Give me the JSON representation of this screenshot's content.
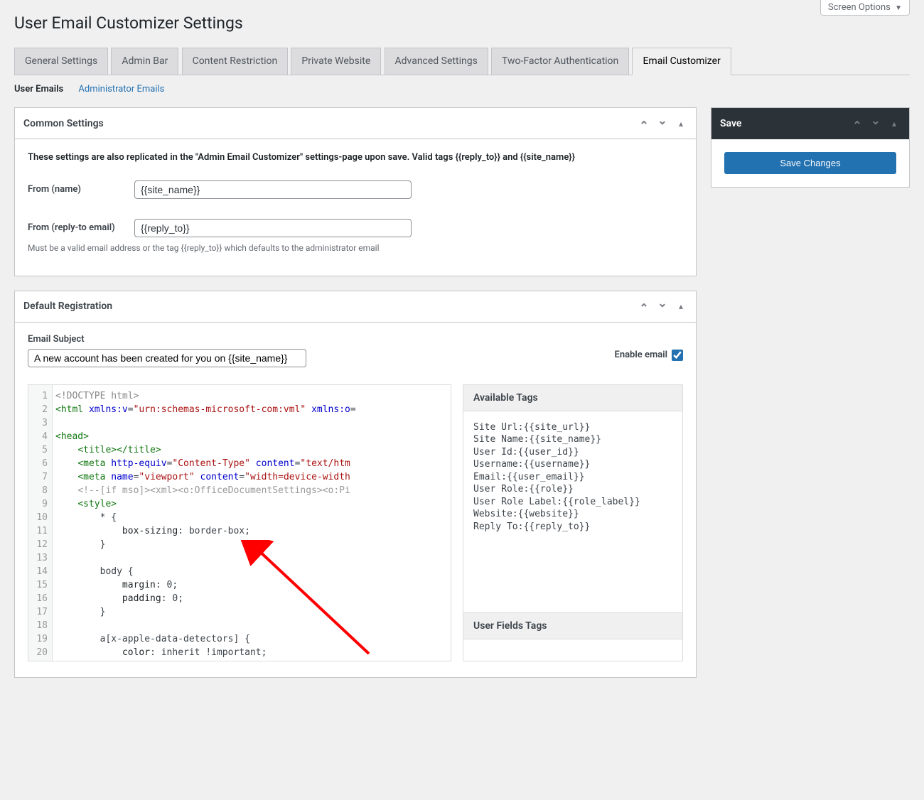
{
  "screen_options": "Screen Options",
  "page_title": "User Email Customizer Settings",
  "tabs": [
    "General Settings",
    "Admin Bar",
    "Content Restriction",
    "Private Website",
    "Advanced Settings",
    "Two-Factor Authentication",
    "Email Customizer"
  ],
  "tabs_active_index": 6,
  "sub_tabs": {
    "active": "User Emails",
    "link": "Administrator Emails"
  },
  "common": {
    "title": "Common Settings",
    "description": "These settings are also replicated in the \"Admin Email Customizer\" settings-page upon save. Valid tags {{reply_to}} and {{site_name}}",
    "from_name_label": "From (name)",
    "from_name_value": "{{site_name}}",
    "from_email_label": "From (reply-to email)",
    "from_email_value": "{{reply_to}}",
    "from_email_desc": "Must be a valid email address or the tag {{reply_to}} which defaults to the administrator email"
  },
  "registration": {
    "title": "Default Registration",
    "subject_label": "Email Subject",
    "subject_value": "A new account has been created for you on {{site_name}}",
    "enable_label": "Enable email",
    "enable_checked": true,
    "available_tags_title": "Available Tags",
    "available_tags": [
      "Site Url:{{site_url}}",
      "Site Name:{{site_name}}",
      "User Id:{{user_id}}",
      "Username:{{username}}",
      "Email:{{user_email}}",
      "User Role:{{role}}",
      "User Role Label:{{role_label}}",
      "Website:{{website}}",
      "Reply To:{{reply_to}}"
    ],
    "user_fields_title": "User Fields Tags",
    "code_lines": [
      {
        "n": 1,
        "html": "<span class='tok-doctype'>&lt;!DOCTYPE html&gt;</span>"
      },
      {
        "n": 2,
        "html": "<span class='tok-tag'>&lt;html</span> <span class='tok-attr'>xmlns:v</span>=<span class='tok-str'>\"urn:schemas-microsoft-com:vml\"</span> <span class='tok-attr'>xmlns:o</span>="
      },
      {
        "n": 3,
        "html": ""
      },
      {
        "n": 4,
        "html": "<span class='tok-tag'>&lt;head&gt;</span>"
      },
      {
        "n": 5,
        "html": "    <span class='tok-tag'>&lt;title&gt;&lt;/title&gt;</span>"
      },
      {
        "n": 6,
        "html": "    <span class='tok-tag'>&lt;meta</span> <span class='tok-attr'>http-equiv</span>=<span class='tok-str'>\"Content-Type\"</span> <span class='tok-attr'>content</span>=<span class='tok-str'>\"text/htm</span>"
      },
      {
        "n": 7,
        "html": "    <span class='tok-tag'>&lt;meta</span> <span class='tok-attr'>name</span>=<span class='tok-str'>\"viewport\"</span> <span class='tok-attr'>content</span>=<span class='tok-str'>\"width=device-width</span>"
      },
      {
        "n": 8,
        "html": "    <span class='tok-comment'>&lt;!--[if mso]&gt;&lt;xml&gt;&lt;o:OfficeDocumentSettings&gt;&lt;o:Pi</span>"
      },
      {
        "n": 9,
        "html": "    <span class='tok-tag'>&lt;style&gt;</span>"
      },
      {
        "n": 10,
        "html": "        * {"
      },
      {
        "n": 11,
        "html": "            <span class='tok-prop'>box-sizing</span>: border-box;"
      },
      {
        "n": 12,
        "html": "        }"
      },
      {
        "n": 13,
        "html": ""
      },
      {
        "n": 14,
        "html": "        body {"
      },
      {
        "n": 15,
        "html": "            <span class='tok-prop'>margin</span>: 0;"
      },
      {
        "n": 16,
        "html": "            <span class='tok-prop'>padding</span>: 0;"
      },
      {
        "n": 17,
        "html": "        }"
      },
      {
        "n": 18,
        "html": ""
      },
      {
        "n": 19,
        "html": "        a[x-apple-data-detectors] {"
      },
      {
        "n": 20,
        "html": "            <span class='tok-prop'>color</span>: inherit !important;"
      }
    ]
  },
  "save_box": {
    "title": "Save",
    "button": "Save Changes"
  }
}
